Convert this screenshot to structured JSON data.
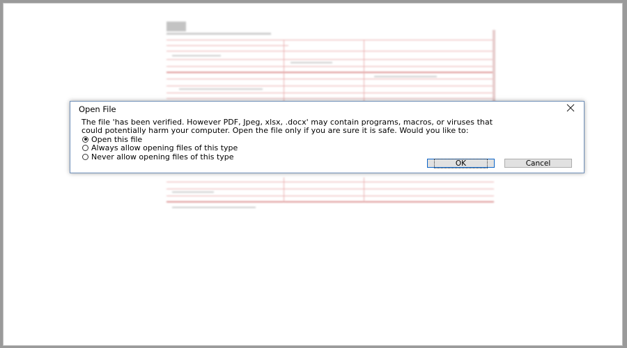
{
  "dialog": {
    "title": "Open File",
    "message_line1": "The file 'has been verified. However PDF, Jpeg, xlsx, .docx' may contain programs, macros, or viruses that",
    "message_line2": "could potentially harm your computer. Open the file only if you are sure it is safe. Would you like to:",
    "options": [
      {
        "label": "Open this file",
        "selected": true
      },
      {
        "label": "Always allow opening files of this type",
        "selected": false
      },
      {
        "label": "Never allow opening files of this type",
        "selected": false
      }
    ],
    "ok_label": "OK",
    "cancel_label": "Cancel",
    "close_icon": "close-icon"
  },
  "colors": {
    "dialog_border": "#6f8fb8",
    "ok_border": "#0a64c8",
    "doc_lines": "#e8a6a6"
  }
}
